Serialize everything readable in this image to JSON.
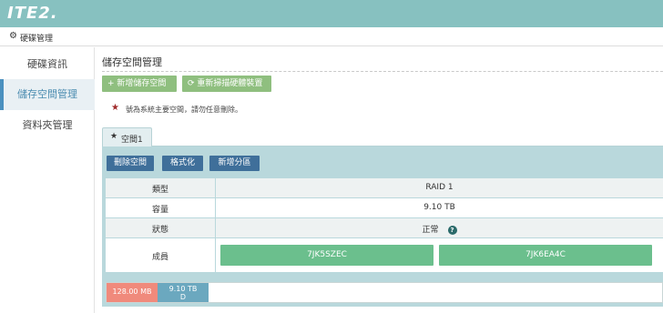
{
  "header": {
    "logo": "ITE2."
  },
  "breadcrumb": {
    "icon": "gear-icon",
    "label": "硬碟管理"
  },
  "sidebar": {
    "items": [
      {
        "label": "硬碟資訊"
      },
      {
        "label": "儲存空間管理"
      },
      {
        "label": "資料夾管理"
      }
    ]
  },
  "main": {
    "title": "儲存空間管理",
    "toolbar": {
      "add_label": "新增儲存空間",
      "rescan_label": "重新掃描硬體裝置"
    },
    "notice": "號為系統主要空間，請勿任意刪除。",
    "tabs": [
      {
        "label": "空間1"
      }
    ],
    "actions": {
      "delete_label": "刪除空間",
      "format_label": "格式化",
      "partition_label": "新增分區"
    },
    "details": {
      "type_label": "類型",
      "type_value": "RAID 1",
      "capacity_label": "容量",
      "capacity_value": "9.10 TB",
      "status_label": "狀態",
      "status_value": "正常",
      "members_label": "成員",
      "members": [
        "7JK5SZEC",
        "7JK6EA4C"
      ]
    },
    "usage": {
      "seg1": "128.00 MB",
      "seg2_line1": "9.10 TB",
      "seg2_line2": "D"
    }
  },
  "colors": {
    "header": "#87c1c0",
    "panel": "#b9d8dc",
    "green_button": "#8fbf7f",
    "blue_button": "#3f6f9a",
    "member": "#6bbf8d"
  }
}
